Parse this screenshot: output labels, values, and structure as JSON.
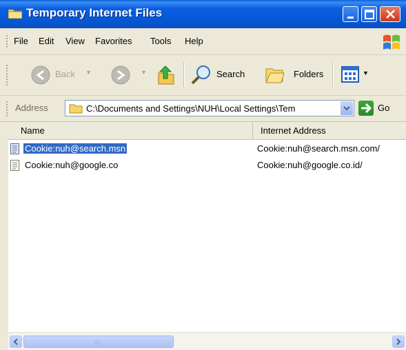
{
  "window": {
    "title": "Temporary Internet Files"
  },
  "menu": [
    "File",
    "Edit",
    "View",
    "Favorites",
    "Tools",
    "Help"
  ],
  "toolbar": {
    "back_label": "Back",
    "search_label": "Search",
    "folders_label": "Folders"
  },
  "address": {
    "label": "Address",
    "value": "C:\\Documents and Settings\\NUH\\Local Settings\\Tem",
    "go_label": "Go"
  },
  "list": {
    "columns": [
      "Name",
      "Internet Address"
    ],
    "rows": [
      {
        "name": "Cookie:nuh@search.msn",
        "address": "Cookie:nuh@search.msn.com/",
        "selected": true
      },
      {
        "name": "Cookie:nuh@google.co",
        "address": "Cookie:nuh@google.co.id/",
        "selected": false
      }
    ]
  },
  "colors": {
    "titlebar": "#0558d6",
    "selection": "#316ac5",
    "chrome": "#ece9d8"
  }
}
